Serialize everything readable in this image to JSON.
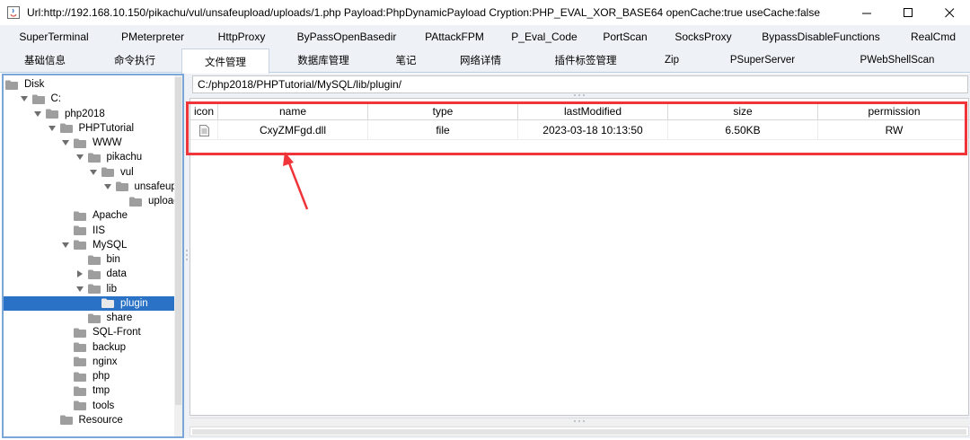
{
  "window": {
    "title": "Url:http://192.168.10.150/pikachu/vul/unsafeupload/uploads/1.php Payload:PhpDynamicPayload Cryption:PHP_EVAL_XOR_BASE64 openCache:true useCache:false",
    "minimize": "—",
    "maximize": "☐",
    "close": "✕"
  },
  "toolbar_row1": [
    {
      "label": "SuperTerminal"
    },
    {
      "label": "PMeterpreter"
    },
    {
      "label": "HttpProxy"
    },
    {
      "label": "ByPassOpenBasedir"
    },
    {
      "label": "PAttackFPM"
    },
    {
      "label": "P_Eval_Code"
    },
    {
      "label": "PortScan"
    },
    {
      "label": "SocksProxy"
    },
    {
      "label": "BypassDisableFunctions"
    },
    {
      "label": "RealCmd"
    }
  ],
  "toolbar_row2": [
    {
      "label": "基础信息"
    },
    {
      "label": "命令执行"
    },
    {
      "label": "文件管理",
      "active": true
    },
    {
      "label": "数据库管理"
    },
    {
      "label": "笔记"
    },
    {
      "label": "网络详情"
    },
    {
      "label": "插件标签管理"
    },
    {
      "label": "Zip"
    },
    {
      "label": "PSuperServer"
    },
    {
      "label": "PWebShellScan"
    }
  ],
  "tree": [
    {
      "label": "Disk",
      "depth": 0,
      "arrow": "",
      "folder": true
    },
    {
      "label": "C:",
      "depth": 1,
      "arrow": "open",
      "folder": true
    },
    {
      "label": "php2018",
      "depth": 2,
      "arrow": "open",
      "folder": true
    },
    {
      "label": "PHPTutorial",
      "depth": 3,
      "arrow": "open",
      "folder": true
    },
    {
      "label": "WWW",
      "depth": 4,
      "arrow": "open",
      "folder": true
    },
    {
      "label": "pikachu",
      "depth": 5,
      "arrow": "open",
      "folder": true
    },
    {
      "label": "vul",
      "depth": 6,
      "arrow": "open",
      "folder": true
    },
    {
      "label": "unsafeuploac",
      "depth": 7,
      "arrow": "open",
      "folder": true
    },
    {
      "label": "uploads",
      "depth": 8,
      "arrow": "",
      "folder": true
    },
    {
      "label": "Apache",
      "depth": 4,
      "arrow": "",
      "folder": true
    },
    {
      "label": "IIS",
      "depth": 4,
      "arrow": "",
      "folder": true
    },
    {
      "label": "MySQL",
      "depth": 4,
      "arrow": "open",
      "folder": true
    },
    {
      "label": "bin",
      "depth": 5,
      "arrow": "",
      "folder": true
    },
    {
      "label": "data",
      "depth": 5,
      "arrow": "closed",
      "folder": true
    },
    {
      "label": "lib",
      "depth": 5,
      "arrow": "open",
      "folder": true
    },
    {
      "label": "plugin",
      "depth": 6,
      "arrow": "",
      "folder": true,
      "selected": true
    },
    {
      "label": "share",
      "depth": 5,
      "arrow": "",
      "folder": true
    },
    {
      "label": "SQL-Front",
      "depth": 4,
      "arrow": "",
      "folder": true
    },
    {
      "label": "backup",
      "depth": 4,
      "arrow": "",
      "folder": true
    },
    {
      "label": "nginx",
      "depth": 4,
      "arrow": "",
      "folder": true
    },
    {
      "label": "php",
      "depth": 4,
      "arrow": "",
      "folder": true
    },
    {
      "label": "tmp",
      "depth": 4,
      "arrow": "",
      "folder": true
    },
    {
      "label": "tools",
      "depth": 4,
      "arrow": "",
      "folder": true
    },
    {
      "label": "Resource",
      "depth": 3,
      "arrow": "",
      "folder": true
    }
  ],
  "path": "C:/php2018/PHPTutorial/MySQL/lib/plugin/",
  "table": {
    "columns": [
      "icon",
      "name",
      "type",
      "lastModified",
      "size",
      "permission"
    ],
    "rows": [
      {
        "name": "CxyZMFgd.dll",
        "type": "file",
        "lastModified": "2023-03-18 10:13:50",
        "size": "6.50KB",
        "permission": "RW"
      }
    ]
  },
  "colors": {
    "annotation": "#f0353a",
    "selection": "#2a72c6",
    "tree_border": "#7aa7d8"
  }
}
